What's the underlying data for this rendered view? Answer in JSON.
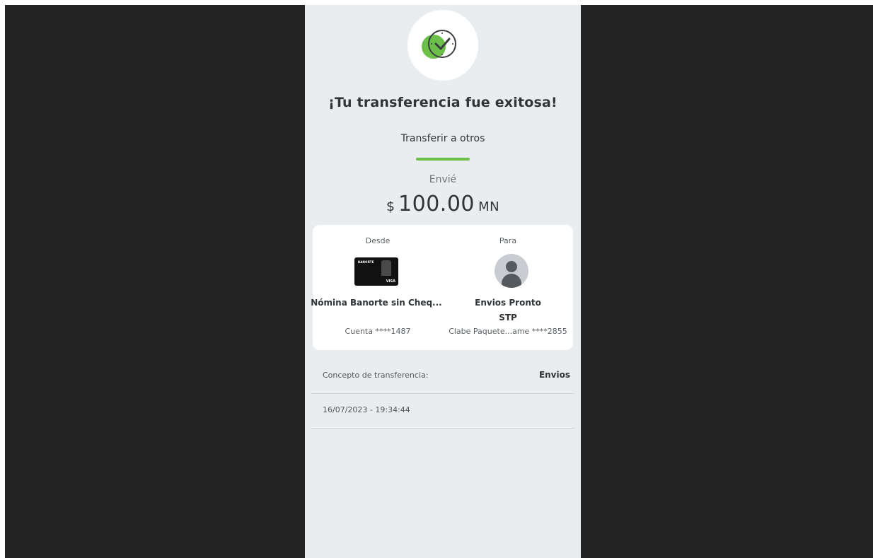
{
  "title": "¡Tu transferencia fue exitosa!",
  "subtitle": "Transferir a otros",
  "accent_color": "#6cc04a",
  "amount": {
    "label": "Envié",
    "currency_symbol": "$",
    "value": "100.00",
    "unit": "MN"
  },
  "from": {
    "label": "Desde",
    "card_bank_text": "BANORTE",
    "card_brand": "VISA",
    "name": "Nómina Banorte sin Cheq...",
    "account": "Cuenta ****1487"
  },
  "to": {
    "label": "Para",
    "name": "Envios Pronto",
    "bank": "STP",
    "account": "Clabe Paquete...ame ****2855"
  },
  "details": {
    "concept_label": "Concepto de transferencia:",
    "concept_value": "Envios",
    "datetime": "16/07/2023 - 19:34:44"
  },
  "icons": {
    "success": "check-circle-icon",
    "avatar": "user-avatar-icon"
  }
}
